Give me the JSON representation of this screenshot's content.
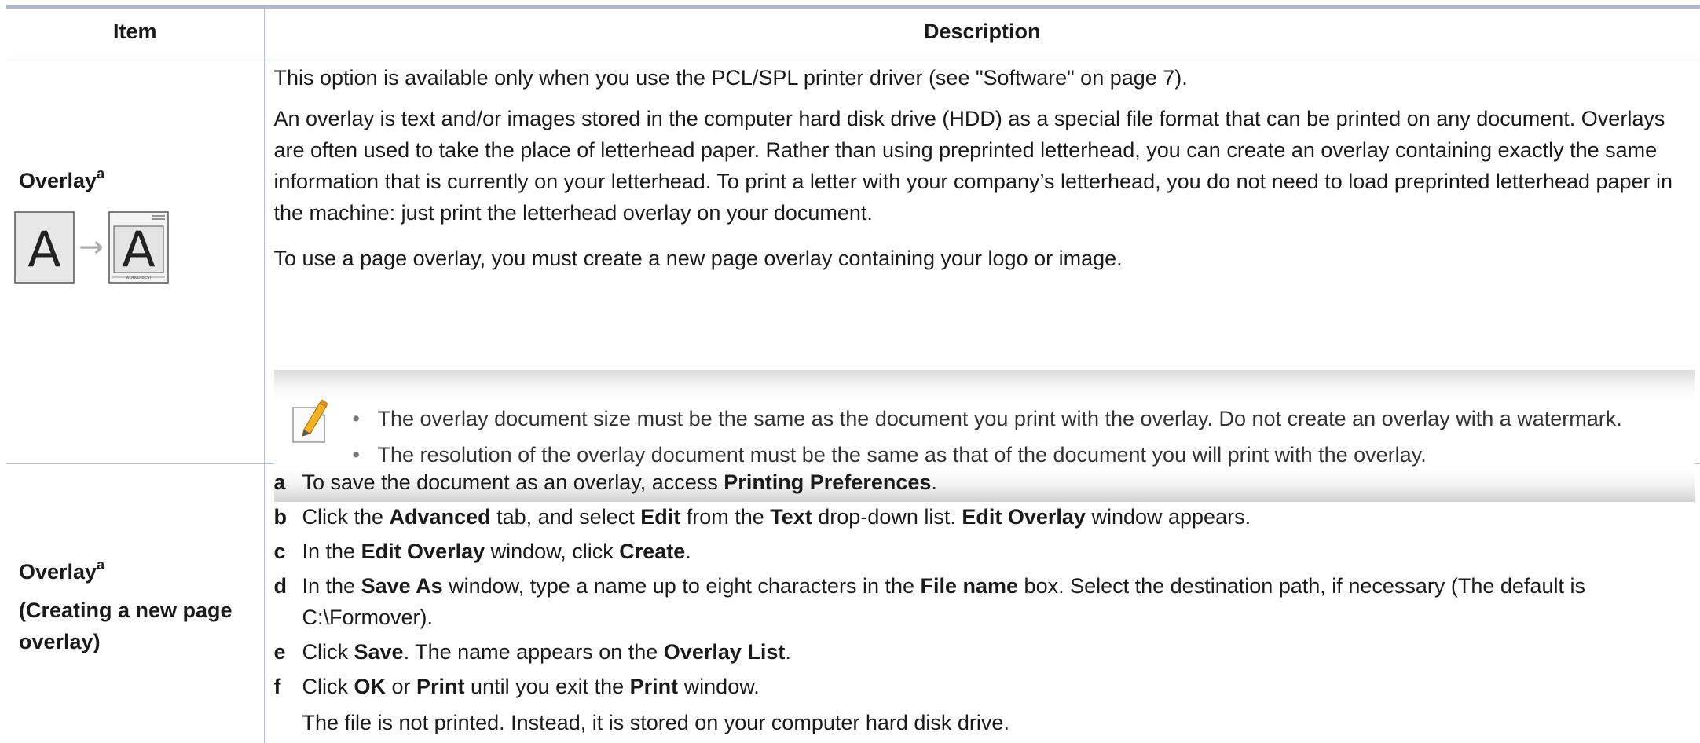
{
  "table": {
    "headers": {
      "item": "Item",
      "description": "Description"
    }
  },
  "overlay_row": {
    "item_title": "Overlay",
    "item_sup": "a",
    "illustration": {
      "before_letter": "A",
      "arrow": "→",
      "after_letter": "A",
      "footer_text": "WORLD BEST"
    },
    "paragraphs": [
      "This option is available only when you use the PCL/SPL printer driver (see \"Software\" on page 7).",
      "An overlay is text and/or images stored in the computer hard disk drive (HDD) as a special file format that can be printed on any document. Overlays are often used to take the place of letterhead paper. Rather than using preprinted letterhead, you can create an overlay containing exactly the same information that is currently on your letterhead. To print a letter with your company’s letterhead, you do not need to load preprinted letterhead paper in the machine: just print the letterhead overlay on your document.",
      "To use a page overlay, you must create a new page overlay containing your logo or image."
    ],
    "note": {
      "icon": "note-pencil-icon",
      "bullets": [
        "The overlay document size must be the same as the document you print with the overlay. Do not create an overlay with a watermark.",
        "The resolution of the overlay document must be the same as that of the document you will print with the overlay."
      ]
    }
  },
  "create_row": {
    "item_title": "Overlay",
    "item_sup": "a",
    "item_subtitle": "(Creating a new page overlay)",
    "steps": [
      {
        "letter": "a",
        "parts": [
          {
            "t": "To save the document as an overlay, access "
          },
          {
            "t": "Printing Preferences",
            "b": true
          },
          {
            "t": "."
          }
        ]
      },
      {
        "letter": "b",
        "parts": [
          {
            "t": "Click the "
          },
          {
            "t": "Advanced",
            "b": true
          },
          {
            "t": " tab, and select "
          },
          {
            "t": "Edit",
            "b": true
          },
          {
            "t": " from the "
          },
          {
            "t": "Text",
            "b": true
          },
          {
            "t": " drop-down list. "
          },
          {
            "t": "Edit Overlay",
            "b": true
          },
          {
            "t": " window appears."
          }
        ]
      },
      {
        "letter": "c",
        "parts": [
          {
            "t": "In the "
          },
          {
            "t": "Edit Overlay",
            "b": true
          },
          {
            "t": " window, click "
          },
          {
            "t": "Create",
            "b": true
          },
          {
            "t": "."
          }
        ]
      },
      {
        "letter": "d",
        "parts": [
          {
            "t": "In the "
          },
          {
            "t": "Save As",
            "b": true
          },
          {
            "t": " window, type a name up to eight characters in the "
          },
          {
            "t": "File name",
            "b": true
          },
          {
            "t": " box. Select the destination path, if necessary (The default is C:\\Formover)."
          }
        ]
      },
      {
        "letter": "e",
        "parts": [
          {
            "t": "Click "
          },
          {
            "t": "Save",
            "b": true
          },
          {
            "t": ". The name appears on the "
          },
          {
            "t": "Overlay List",
            "b": true
          },
          {
            "t": "."
          }
        ]
      },
      {
        "letter": "f",
        "parts": [
          {
            "t": "Click "
          },
          {
            "t": "OK",
            "b": true
          },
          {
            "t": " or "
          },
          {
            "t": "Print",
            "b": true
          },
          {
            "t": " until you exit the "
          },
          {
            "t": "Print",
            "b": true
          },
          {
            "t": " window."
          }
        ]
      }
    ],
    "final_note": "The file is not printed. Instead, it is stored on your computer hard disk drive."
  },
  "colors": {
    "rule": "#b3b7d2",
    "grid": "#b9bfd0",
    "text": "#1a1a1a"
  }
}
